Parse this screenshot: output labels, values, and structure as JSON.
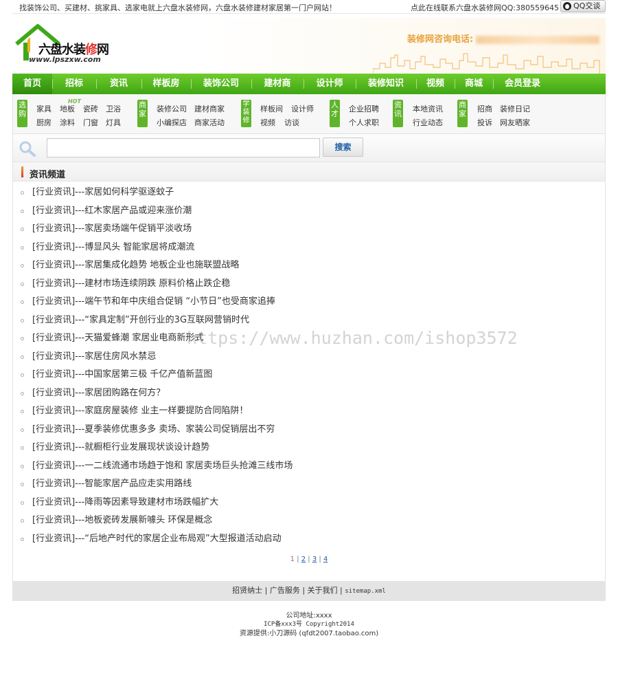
{
  "topbar": {
    "left_text": "找装饰公司、买建材、挑家具、选家电就上六盘水装修网，六盘水装修建材家居第一门户网站！",
    "right_text": "点此在线联系六盘水装修网QQ:380559645",
    "qq_button": "QQ交谈"
  },
  "header": {
    "logo_name_a": "六盘水装",
    "logo_name_b": "修",
    "logo_name_c": "网",
    "logo_domain": "www.lpszxw.com",
    "hotline_label": "装修网咨询电话:"
  },
  "nav": {
    "items": [
      "首页",
      "招标",
      "资讯",
      "样板房",
      "装饰公司",
      "建材商",
      "设计师",
      "装修知识",
      "视频",
      "商城",
      "会员登录"
    ]
  },
  "subnav": {
    "groups": [
      {
        "badge": "选购",
        "links": [
          "家具",
          "地板",
          "瓷砖",
          "卫浴",
          "厨房",
          "涂料",
          "门窗",
          "灯具"
        ],
        "hot": "HOT"
      },
      {
        "badge": "商家",
        "links": [
          "装修公司",
          "建材商家",
          "小编探店",
          "商家活动"
        ]
      },
      {
        "badge": "学装修",
        "links": [
          "样板间",
          "设计师",
          "视频",
          "访谈"
        ]
      },
      {
        "badge": "人才",
        "links": [
          "企业招聘",
          "个人求职"
        ]
      },
      {
        "badge": "资讯",
        "links": [
          "本地资讯",
          "行业动态"
        ]
      },
      {
        "badge": "商家",
        "links": [
          "招商",
          "装修日记",
          "投诉",
          "网友晒家"
        ]
      }
    ]
  },
  "search": {
    "button": "搜索",
    "value": ""
  },
  "channel": {
    "title": "资讯频道",
    "items": [
      "[行业资讯]---家居如何科学驱逐蚊子",
      "[行业资讯]---红木家居产品或迎来涨价潮",
      "[行业资讯]---家居卖场端午促销平淡收场",
      "[行业资讯]---博显风头 智能家居将成潮流",
      "[行业资讯]---家居集成化趋势 地板企业也施联盟战略",
      "[行业资讯]---建材市场连续阴跌 原料价格止跌企稳",
      "[行业资讯]---端午节和年中庆组合促销 “小节日”也受商家追捧",
      "[行业资讯]---“家具定制”开创行业的3G互联网营销时代",
      "[行业资讯]---天猫爱蜂潮 家居业电商新形式",
      "[行业资讯]---家居住房风水禁忌",
      "[行业资讯]---中国家居第三极 千亿产值新蓝图",
      "[行业资讯]---家居团购路在何方？",
      "[行业资讯]---家庭房屋装修 业主一样要提防合同陷阱！",
      "[行业资讯]---夏季装修优惠多多 卖场、家装公司促销层出不穷",
      "[行业资讯]---就橱柜行业发展现状谈设计趋势",
      "[行业资讯]---一二线流通市场趋于饱和 家居卖场巨头抢滩三线市场",
      "[行业资讯]---智能家居产品应走实用路线",
      "[行业资讯]---降雨等因素导致建材市场跌幅扩大",
      "[行业资讯]---地板瓷砖发展新噱头 环保是概念",
      "[行业资讯]---“后地产时代的家居企业布局观”大型报道活动启动"
    ],
    "pager": {
      "current": "1",
      "pages": [
        "2",
        "3",
        "4"
      ]
    }
  },
  "footer": {
    "links": [
      "招贤纳士",
      "广告服务",
      "关于我们",
      "sitemap.xml"
    ],
    "address": "公司地址:xxxx",
    "icp": "ICP备xxx3号 Copyright2014",
    "source": "资源提供:小刀源码 (qfdt2007.taobao.com)"
  },
  "watermark": "https://www.huzhan.com/ishop3572",
  "colors": {
    "nav_green": "#4cb21c",
    "badge_green": "#5fb52a",
    "link_blue": "#1e5fa5",
    "hotline_orange": "#e8a33e"
  }
}
